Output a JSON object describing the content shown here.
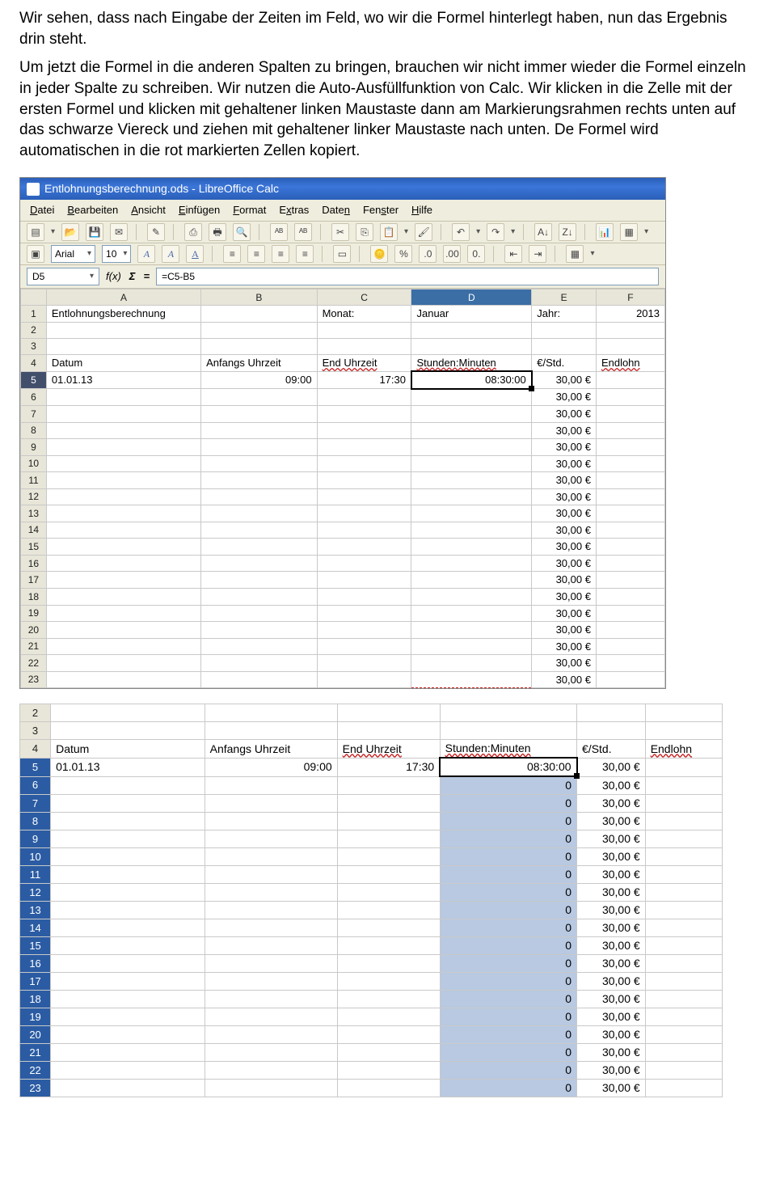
{
  "para1": "Wir sehen, dass nach Eingabe der Zeiten im Feld, wo wir die Formel hinterlegt haben, nun das Ergebnis drin steht.",
  "para2": "Um jetzt die Formel in die anderen Spalten zu bringen, brauchen wir nicht immer wieder die Formel einzeln in jeder Spalte zu schreiben. Wir nutzen die Auto-Ausfüllfunktion von Calc. Wir klicken in die Zelle mit der ersten Formel und klicken mit gehaltener linken Maustaste dann am Markierungsrahmen rechts unten auf das schwarze Viereck und ziehen mit gehaltener linker Maustaste nach unten. De Formel wird automatischen in die rot markierten Zellen kopiert.",
  "window": {
    "title": "Entlohnungsberechnung.ods - LibreOffice Calc",
    "menus": [
      "Datei",
      "Bearbeiten",
      "Ansicht",
      "Einfügen",
      "Format",
      "Extras",
      "Daten",
      "Fenster",
      "Hilfe"
    ],
    "font_name": "Arial",
    "font_size": "10",
    "cell_ref": "D5",
    "formula": "=C5-B5"
  },
  "sheet": {
    "cols": [
      "A",
      "B",
      "C",
      "D",
      "E",
      "F"
    ],
    "row1": {
      "A": "Entlohnungsberechnung",
      "C": "Monat:",
      "D": "Januar",
      "E": "Jahr:",
      "F": "2013"
    },
    "row4": {
      "A": "Datum",
      "B": "Anfangs Uhrzeit",
      "C": "End Uhrzeit",
      "D": "Stunden:Minuten",
      "E": "€/Std.",
      "F": "Endlohn"
    },
    "row5": {
      "A": "01.01.13",
      "B": "09:00",
      "C": "17:30",
      "D": "08:30:00",
      "E": "30,00 €"
    },
    "rate": "30,00 €",
    "rownums1_start": 1,
    "rownums1_end": 23
  },
  "sheet2": {
    "header": {
      "A": "Datum",
      "B": "Anfangs Uhrzeit",
      "C": "End Uhrzeit",
      "D": "Stunden:Minuten",
      "E": "€/Std.",
      "F": "Endlohn"
    },
    "row5": {
      "A": "01.01.13",
      "B": "09:00",
      "C": "17:30",
      "D": "08:30:00",
      "E": "30,00 €"
    },
    "fill_val": "0",
    "rate": "30,00 €",
    "rownums": [
      "2",
      "3",
      "4",
      "5",
      "6",
      "7",
      "8",
      "9",
      "10",
      "11",
      "12",
      "13",
      "14",
      "15",
      "16",
      "17",
      "18",
      "19",
      "20",
      "21",
      "22",
      "23"
    ]
  }
}
